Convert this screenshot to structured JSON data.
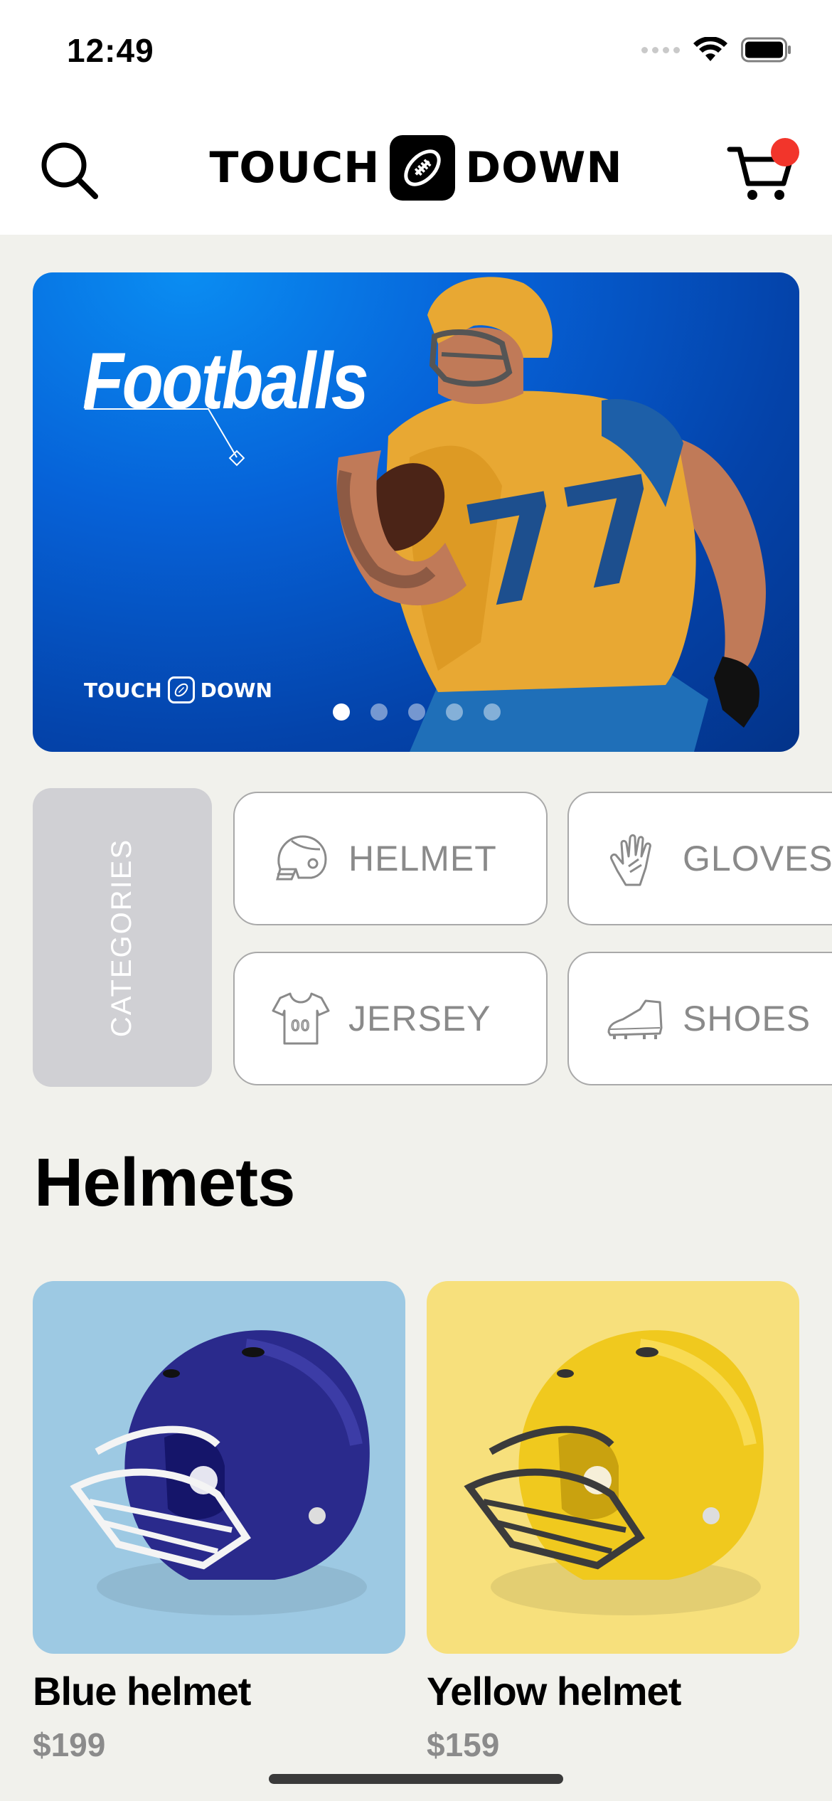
{
  "status_bar": {
    "time": "12:49"
  },
  "header": {
    "brand_left": "TOUCH",
    "brand_right": "DOWN",
    "search_icon": "search-icon",
    "cart_icon": "cart-icon",
    "cart_badge_color": "#f2352b"
  },
  "hero": {
    "title": "Footballs",
    "brand_left": "TOUCH",
    "brand_right": "DOWN",
    "slide_count": 5,
    "active_slide": 1,
    "background_color": "#0662d8"
  },
  "categories": {
    "label": "CATEGORIES",
    "items": [
      {
        "label": "HELMET",
        "icon": "helmet-icon"
      },
      {
        "label": "GLOVES",
        "icon": "gloves-icon"
      },
      {
        "label": "JERSEY",
        "icon": "jersey-icon"
      },
      {
        "label": "SHOES",
        "icon": "shoes-icon"
      }
    ]
  },
  "section": {
    "title": "Helmets"
  },
  "products": [
    {
      "name": "Blue helmet",
      "price": "$199",
      "card_color": "#9dc9e3",
      "helmet_color": "#2a2a8c"
    },
    {
      "name": "Yellow helmet",
      "price": "$159",
      "card_color": "#f7e07c",
      "helmet_color": "#f0c91e"
    }
  ]
}
